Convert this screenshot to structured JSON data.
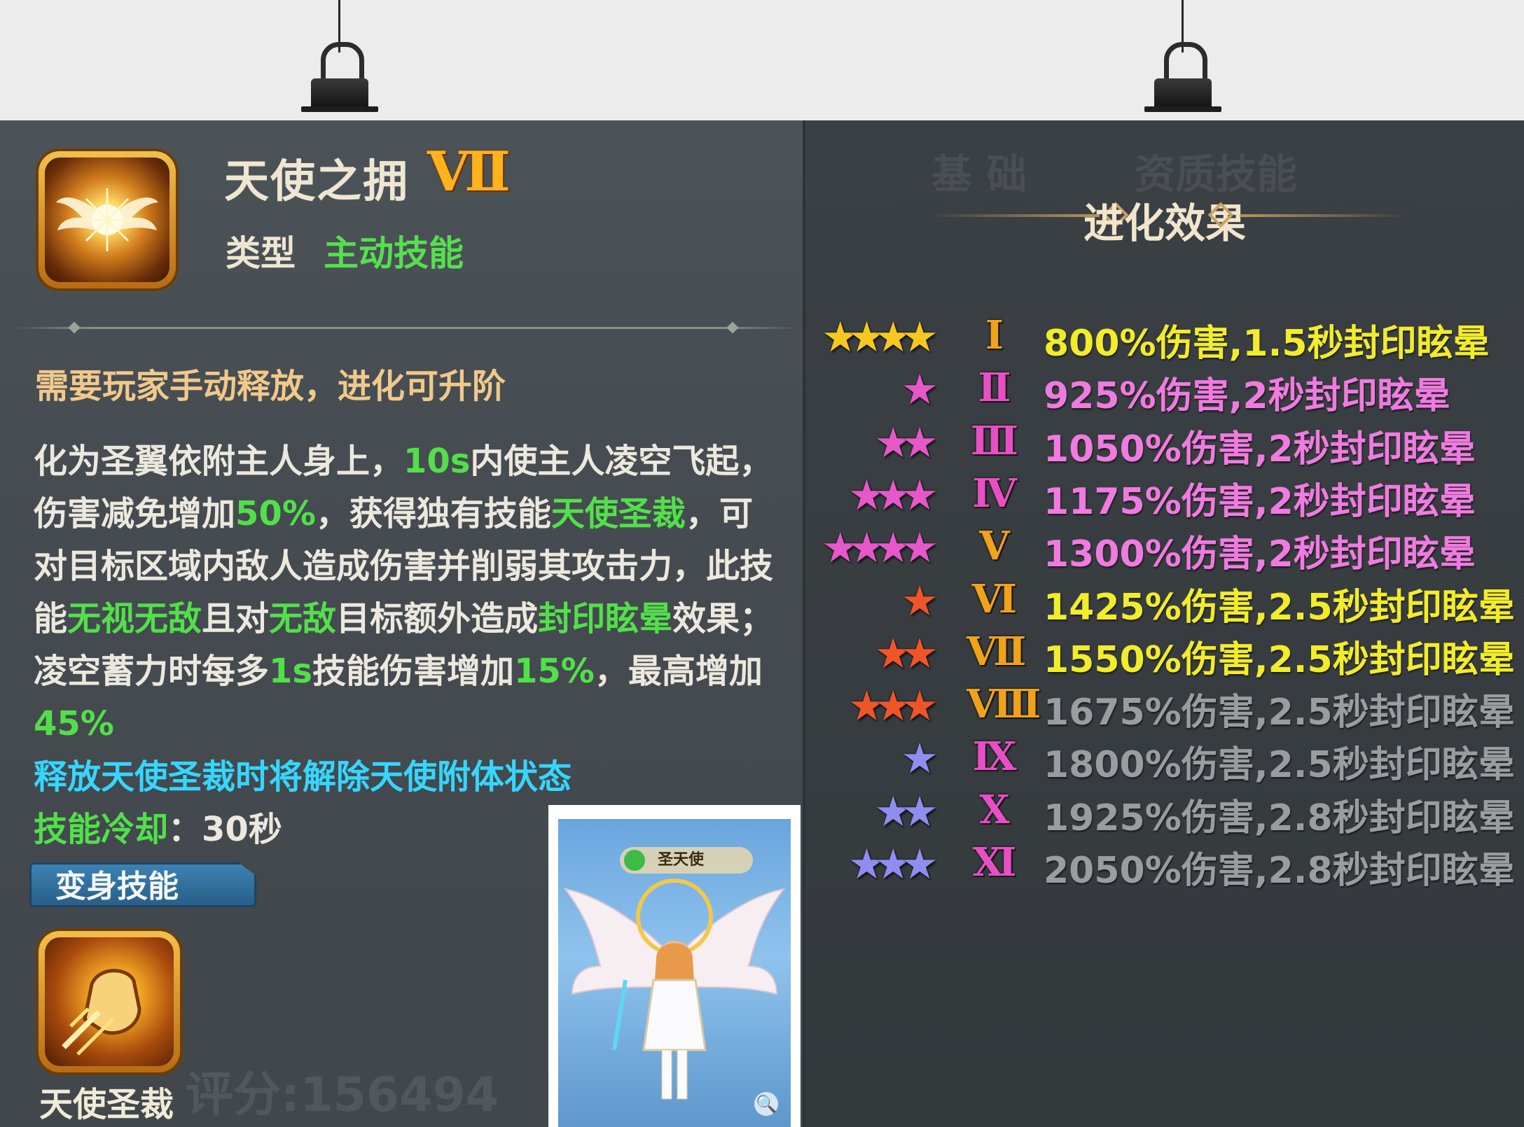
{
  "skill": {
    "name": "天使之拥",
    "level_roman": "Ⅶ",
    "type_label": "类型",
    "type_value": "主动技能",
    "note": "需要玩家手动释放，进化可升阶",
    "description": [
      {
        "t": "化为圣翼依附主人身上，",
        "h": false
      },
      {
        "t": "10s",
        "h": true
      },
      {
        "t": "内使主人凌空飞起，伤害减免增加",
        "h": false
      },
      {
        "t": "50%",
        "h": true
      },
      {
        "t": "，获得独有技能",
        "h": false
      },
      {
        "t": "天使圣裁",
        "h": true
      },
      {
        "t": "，可对目标区域内敌人造成伤害并削弱其攻击力，此技能",
        "h": false
      },
      {
        "t": "无视无敌",
        "h": true
      },
      {
        "t": "且对",
        "h": false
      },
      {
        "t": "无敌",
        "h": true
      },
      {
        "t": "目标额外造成",
        "h": false
      },
      {
        "t": "封印眩晕",
        "h": true
      },
      {
        "t": "效果；凌空蓄力时每多",
        "h": false
      },
      {
        "t": "1s",
        "h": true
      },
      {
        "t": "技能伤害增加",
        "h": false
      },
      {
        "t": "15%",
        "h": true
      },
      {
        "t": "，最高增加",
        "h": false
      },
      {
        "t": "45%",
        "h": true
      }
    ],
    "warning": "释放天使圣裁时将解除天使附体状态",
    "cooldown_label": "技能冷却",
    "cooldown_value": "：30秒",
    "tag": "变身技能",
    "sub_skill_name": "天使圣裁"
  },
  "background_ghost": {
    "score": "评分:156494"
  },
  "photo": {
    "nameplate": "圣天使",
    "zoom_icon": "zoom-icon"
  },
  "evolution": {
    "title": "进化效果",
    "rows": [
      {
        "roman": "Ⅰ",
        "stars": 4,
        "star_color": "#f6c81f",
        "roman_color": "#f0a21a",
        "text": "800%伤害,1.5秒封印眩晕",
        "text_color": "#f2ec2a"
      },
      {
        "roman": "Ⅱ",
        "stars": 1,
        "star_color": "#e657c9",
        "roman_color": "#e84fc5",
        "text": "925%伤害,2秒封印眩晕",
        "text_color": "#f07be0"
      },
      {
        "roman": "Ⅲ",
        "stars": 2,
        "star_color": "#e657c9",
        "roman_color": "#e84fc5",
        "text": "1050%伤害,2秒封印眩晕",
        "text_color": "#f07be0"
      },
      {
        "roman": "Ⅳ",
        "stars": 3,
        "star_color": "#e657c9",
        "roman_color": "#e84fc5",
        "text": "1175%伤害,2秒封印眩晕",
        "text_color": "#f07be0"
      },
      {
        "roman": "Ⅴ",
        "stars": 4,
        "star_color": "#e657c9",
        "roman_color": "#f0a21a",
        "text": "1300%伤害,2秒封印眩晕",
        "text_color": "#f07be0"
      },
      {
        "roman": "Ⅵ",
        "stars": 1,
        "star_color": "#f0552a",
        "roman_color": "#f0a21a",
        "text": "1425%伤害,2.5秒封印眩晕",
        "text_color": "#f2ec2a"
      },
      {
        "roman": "Ⅶ",
        "stars": 2,
        "star_color": "#f0552a",
        "roman_color": "#f0a21a",
        "text": "1550%伤害,2.5秒封印眩晕",
        "text_color": "#f2ec2a"
      },
      {
        "roman": "Ⅷ",
        "stars": 3,
        "star_color": "#f0552a",
        "roman_color": "#f0a21a",
        "text": "1675%伤害,2.5秒封印眩晕",
        "text_color": "#9a9d9f"
      },
      {
        "roman": "Ⅸ",
        "stars": 1,
        "star_color": "#8f8df0",
        "roman_color": "#e84fc5",
        "text": "1800%伤害,2.5秒封印眩晕",
        "text_color": "#9a9d9f"
      },
      {
        "roman": "Ⅹ",
        "stars": 2,
        "star_color": "#8f8df0",
        "roman_color": "#e84fc5",
        "text": "1925%伤害,2.8秒封印眩晕",
        "text_color": "#9a9d9f"
      },
      {
        "roman": "Ⅺ",
        "stars": 3,
        "star_color": "#8f8df0",
        "roman_color": "#e84fc5",
        "text": "2050%伤害,2.8秒封印眩晕",
        "text_color": "#9a9d9f"
      }
    ]
  },
  "colors": {
    "highlight_green": "#52e04a",
    "warning_cyan": "#35d6ff",
    "note_gold": "#f1c98b"
  }
}
